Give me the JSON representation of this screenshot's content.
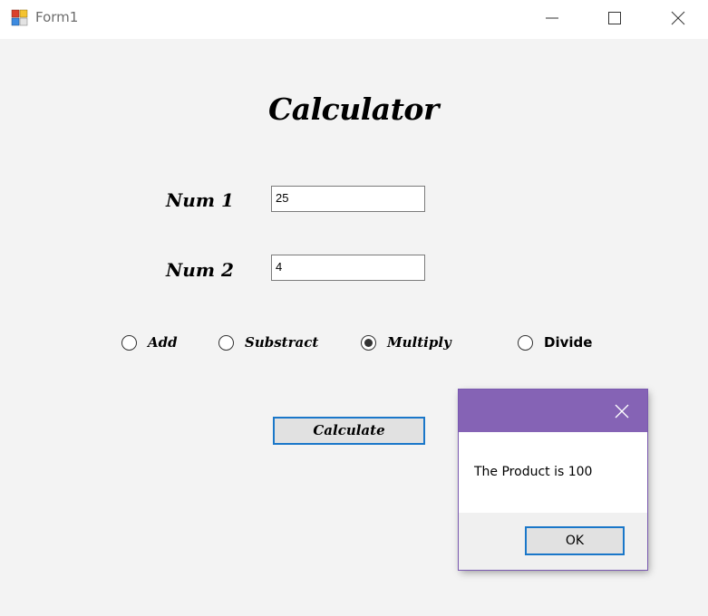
{
  "window": {
    "title": "Form1",
    "icon": "winforms-app-icon",
    "controls": [
      "minimize-icon",
      "maximize-icon",
      "close-icon"
    ]
  },
  "form": {
    "heading": "Calculator",
    "num1": {
      "label": "Num 1",
      "value": "25"
    },
    "num2": {
      "label": "Num 2",
      "value": "4"
    },
    "operations": [
      {
        "label": "Add",
        "checked": false
      },
      {
        "label": "Substract",
        "checked": false
      },
      {
        "label": "Multiply",
        "checked": true
      },
      {
        "label": "Divide",
        "checked": false
      }
    ],
    "calculate_label": "Calculate"
  },
  "messagebox": {
    "title": "",
    "text": "The Product is 100",
    "ok_label": "OK",
    "title_color": "#8563b5"
  },
  "colors": {
    "accent": "#1a77c9",
    "form_background": "#f3f3f3"
  }
}
